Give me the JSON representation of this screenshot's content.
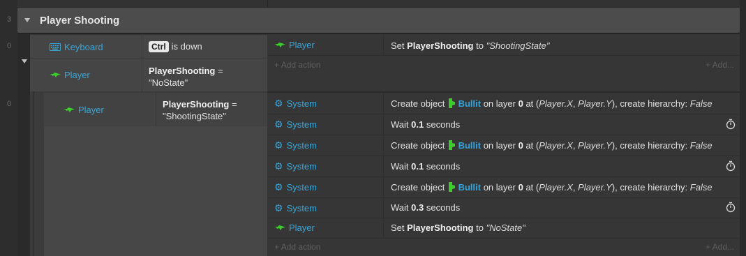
{
  "gutter": {
    "numbers": [
      "3",
      "0",
      "0"
    ]
  },
  "group": {
    "title": "Player Shooting"
  },
  "event1": {
    "conditions": [
      {
        "object": "Keyboard",
        "icon": "keyboard-icon",
        "key": "Ctrl",
        "text": "is down"
      },
      {
        "object": "Player",
        "icon": "player-icon",
        "var": "PlayerShooting",
        "op": "=",
        "value": "\"NoState\""
      }
    ],
    "actions": [
      {
        "object": "Player",
        "pre": "Set",
        "var": "PlayerShooting",
        "mid": "to",
        "value": "\"ShootingState\""
      }
    ],
    "add_action": "Add action",
    "add": "Add..."
  },
  "event2": {
    "condition": {
      "object": "Player",
      "var": "PlayerShooting",
      "op": "=",
      "value": "\"ShootingState\""
    },
    "actions": [
      {
        "object": "System",
        "kind": "create",
        "pre": "Create object",
        "target": "Bullit",
        "layer_pre": "on layer",
        "layer": "0",
        "at": "at (",
        "x": "Player.X",
        "sep": ",",
        "y": "Player.Y",
        "end": "), create hierarchy:",
        "hier": "False"
      },
      {
        "object": "System",
        "kind": "wait",
        "pre": "Wait",
        "value": "0.1",
        "unit": "seconds"
      },
      {
        "object": "System",
        "kind": "create",
        "pre": "Create object",
        "target": "Bullit",
        "layer_pre": "on layer",
        "layer": "0",
        "at": "at (",
        "x": "Player.X",
        "sep": ",",
        "y": "Player.Y",
        "end": "), create hierarchy:",
        "hier": "False"
      },
      {
        "object": "System",
        "kind": "wait",
        "pre": "Wait",
        "value": "0.1",
        "unit": "seconds"
      },
      {
        "object": "System",
        "kind": "create",
        "pre": "Create object",
        "target": "Bullit",
        "layer_pre": "on layer",
        "layer": "0",
        "at": "at (",
        "x": "Player.X",
        "sep": ",",
        "y": "Player.Y",
        "end": "), create hierarchy:",
        "hier": "False"
      },
      {
        "object": "System",
        "kind": "wait",
        "pre": "Wait",
        "value": "0.3",
        "unit": "seconds"
      },
      {
        "object": "Player",
        "kind": "set",
        "pre": "Set",
        "var": "PlayerShooting",
        "mid": "to",
        "value": "\"NoState\""
      }
    ],
    "add_action": "Add action",
    "add": "Add..."
  },
  "colors": {
    "accent_blue": "#3aa6d8",
    "player_green": "#3ccc2c",
    "group_header": "#4c4c4c"
  }
}
